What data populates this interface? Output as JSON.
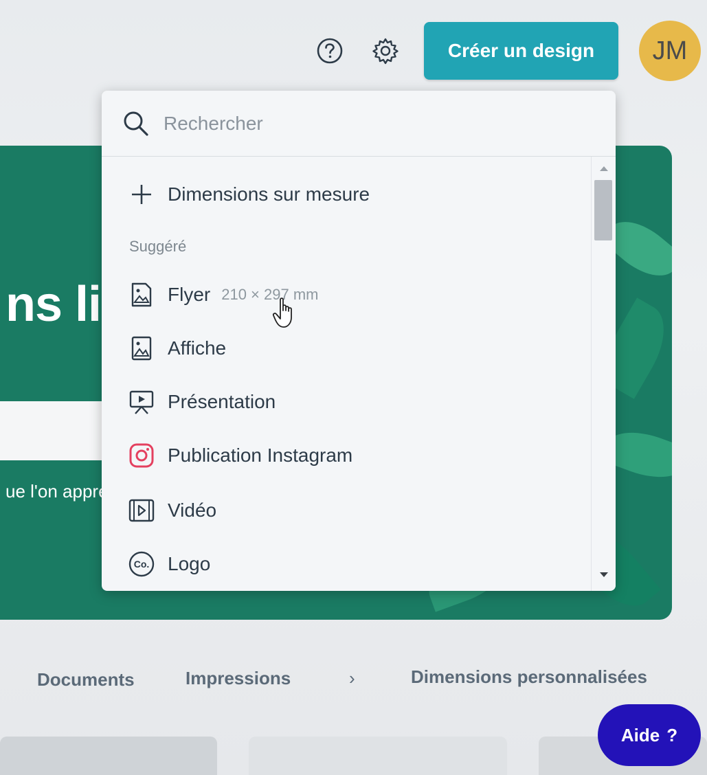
{
  "topbar": {
    "help_icon": "question-circle-icon",
    "settings_icon": "gear-icon",
    "create_button": "Créer un design",
    "avatar_initials": "JM"
  },
  "banner": {
    "title_fragment": "ns li",
    "subtitle_fragment": "ue l'on appre"
  },
  "dropdown": {
    "search_placeholder": "Rechercher",
    "custom_dimensions": "Dimensions sur mesure",
    "section_suggested": "Suggéré",
    "items": [
      {
        "label": "Flyer",
        "dimensions": "210 × 297 mm",
        "icon": "flyer-icon"
      },
      {
        "label": "Affiche",
        "dimensions": "",
        "icon": "poster-icon"
      },
      {
        "label": "Présentation",
        "dimensions": "",
        "icon": "presentation-icon"
      },
      {
        "label": "Publication Instagram",
        "dimensions": "",
        "icon": "instagram-icon"
      },
      {
        "label": "Vidéo",
        "dimensions": "",
        "icon": "video-icon"
      },
      {
        "label": "Logo",
        "dimensions": "",
        "icon": "logo-icon"
      }
    ]
  },
  "categories": {
    "documents": "Documents",
    "impressions": "Impressions",
    "chevron": "›",
    "custom": "Dimensions personnalisées"
  },
  "help_fab": {
    "label": "Aide",
    "symbol": "?"
  },
  "colors": {
    "accent_teal": "#21a4b4",
    "banner_green": "#1a7b63",
    "avatar_yellow": "#e7b94a",
    "fab_blue": "#2312b8",
    "instagram": "#e4405f"
  }
}
